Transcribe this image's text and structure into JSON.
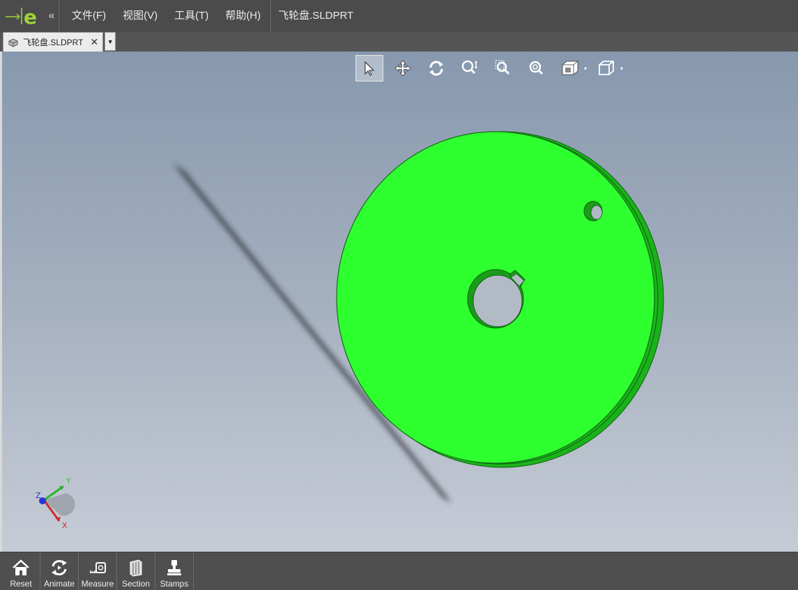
{
  "menubar": {
    "collapse_icon": "«",
    "items": [
      {
        "label": "文件(F)"
      },
      {
        "label": "视图(V)"
      },
      {
        "label": "工具(T)"
      },
      {
        "label": "帮助(H)"
      }
    ],
    "document_title": "飞轮盘.SLDPRT"
  },
  "tabs": [
    {
      "label": "飞轮盘.SLDPRT",
      "close": "✕"
    }
  ],
  "tab_dropdown": "▼",
  "view_toolbar": {
    "tools": [
      "select-icon",
      "pan-icon",
      "rotate-icon",
      "zoom-icon",
      "zoom-window-icon",
      "zoom-fit-icon",
      "view-orientation-icon",
      "display-style-icon"
    ],
    "dropdown": "▾"
  },
  "triad": {
    "x": "X",
    "y": "Y",
    "z": "Z"
  },
  "bottom_toolbar": [
    {
      "label": "Reset",
      "icon": "home-icon"
    },
    {
      "label": "Animate",
      "icon": "animate-icon"
    },
    {
      "label": "Measure",
      "icon": "measure-icon"
    },
    {
      "label": "Section",
      "icon": "section-icon"
    },
    {
      "label": "Stamps",
      "icon": "stamps-icon"
    }
  ],
  "colors": {
    "part": "#2eff2e",
    "part_edge": "#1a8a1a",
    "logo": "#9fd23b"
  }
}
